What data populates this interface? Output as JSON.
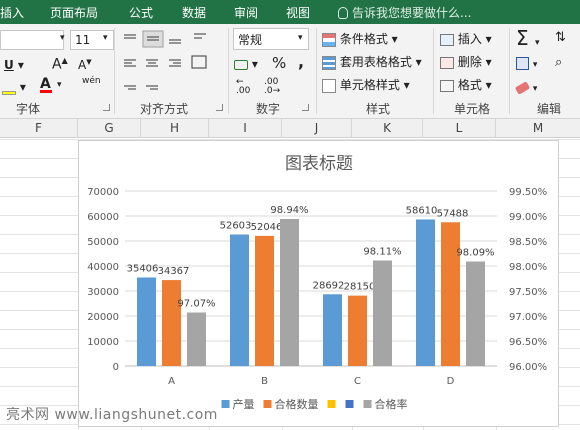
{
  "tabs": [
    "插入",
    "页面布局",
    "公式",
    "数据",
    "审阅",
    "视图"
  ],
  "tell_me": "告诉我您想要做什么...",
  "ribbon": {
    "font_size": "11",
    "number_format": "常规",
    "groups": {
      "font": "字体",
      "align": "对齐方式",
      "number": "数字",
      "styles": "样式",
      "cells": "单元格",
      "edit": "编辑"
    },
    "styles_buttons": [
      "条件格式",
      "套用表格格式",
      "单元格样式"
    ],
    "cells_buttons": [
      "插入",
      "删除",
      "格式"
    ],
    "percent": "%",
    "comma": ",",
    "wen": "wén",
    "dec_inc": ".00",
    "dec_dec": ".0"
  },
  "columns": [
    "F",
    "G",
    "H",
    "I",
    "J",
    "K",
    "L",
    "M"
  ],
  "colors": {
    "excel_green": "#217346",
    "series_output": "#5B9BD5",
    "series_pass_qty": "#ED7D31",
    "series_yellow": "#FFC000",
    "series_blue": "#4472C4",
    "series_rate": "#A5A5A5"
  },
  "chart_data": {
    "type": "bar",
    "title": "图表标题",
    "categories": [
      "A",
      "B",
      "C",
      "D"
    ],
    "series": [
      {
        "name": "产量",
        "axis": "primary",
        "values": [
          35406,
          52603,
          28692,
          58610
        ],
        "labels": [
          "35406",
          "52603",
          "28692",
          "58610"
        ]
      },
      {
        "name": "合格数量",
        "axis": "primary",
        "values": [
          34367,
          52046,
          28150,
          57488
        ],
        "labels": [
          "34367",
          "52046",
          "28150",
          "57488"
        ]
      },
      {
        "name": "合格率",
        "axis": "secondary",
        "values": [
          97.07,
          98.94,
          98.11,
          98.09
        ],
        "labels": [
          "97.07%",
          "98.94%",
          "98.11%",
          "98.09%"
        ]
      }
    ],
    "legend": [
      {
        "name": "产量",
        "color": "#5B9BD5"
      },
      {
        "name": "合格数量",
        "color": "#ED7D31"
      },
      {
        "name": "",
        "color": "#FFC000"
      },
      {
        "name": "",
        "color": "#4472C4"
      },
      {
        "name": "合格率",
        "color": "#A5A5A5"
      }
    ],
    "ylim": [
      0,
      70000
    ],
    "yticks": [
      "0",
      "10000",
      "20000",
      "30000",
      "40000",
      "50000",
      "60000",
      "70000"
    ],
    "y2lim": [
      96.0,
      99.5
    ],
    "y2ticks": [
      "96.00%",
      "96.50%",
      "97.00%",
      "97.50%",
      "98.00%",
      "98.50%",
      "99.00%",
      "99.50%"
    ],
    "grid": true,
    "legend_position": "bottom"
  },
  "watermark": "亮术网 www.liangshunet.com"
}
